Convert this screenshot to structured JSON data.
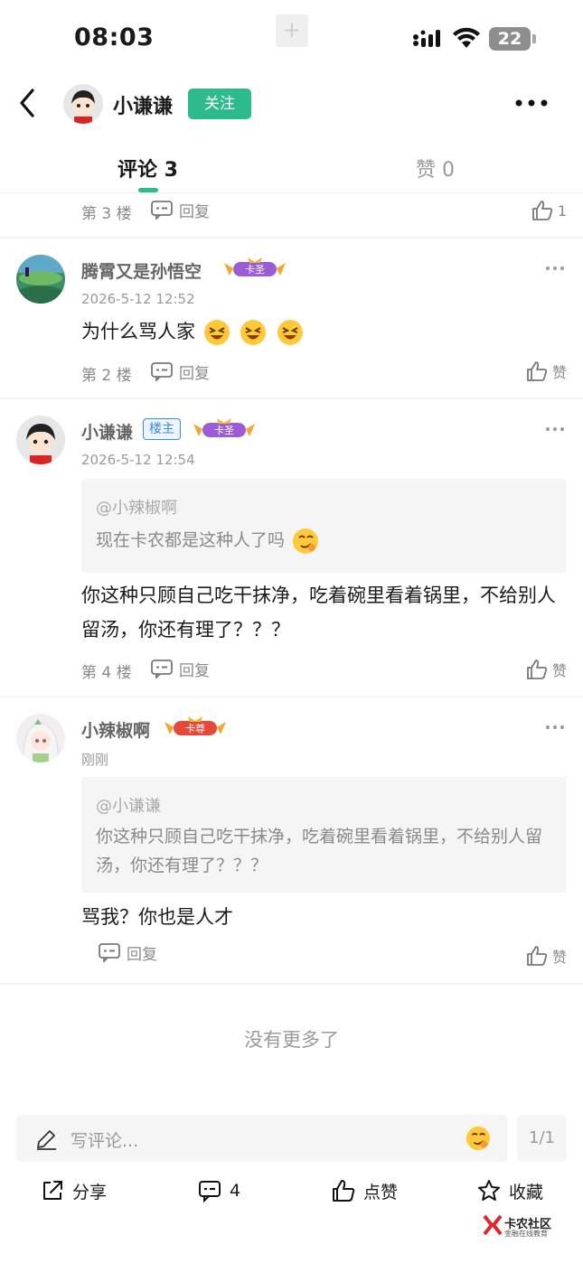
{
  "status_bar": {
    "time": "08:03",
    "battery": "22",
    "plus": "+"
  },
  "header": {
    "username": "小谦谦",
    "follow_label": "关注"
  },
  "tabs": {
    "comments": "评论 3",
    "likes": "赞 0"
  },
  "comments": [
    {
      "floor": "第 3 楼",
      "reply": "回复",
      "likes": "1"
    },
    {
      "name": "腾霄又是孙悟空",
      "badge": "卡圣",
      "time": "2026-5-12 12:52",
      "text": "为什么骂人家",
      "floor": "第 2 楼",
      "reply": "回复",
      "like": "赞"
    },
    {
      "name": "小谦谦",
      "owner_tag": "楼主",
      "badge": "卡圣",
      "time": "2026-5-12 12:54",
      "quote_author": "@小辣椒啊",
      "quote_text": "现在卡农都是这种人了吗",
      "text": "你这种只顾自己吃干抹净，吃着碗里看着锅里，不给别人留汤，你还有理了？？？",
      "floor": "第 4 楼",
      "reply": "回复",
      "like": "赞"
    },
    {
      "name": "小辣椒啊",
      "badge": "卡尊",
      "time": "刚刚",
      "quote_author": "@小谦谦",
      "quote_text": "你这种只顾自己吃干抹净，吃着碗里看着锅里，不给别人留汤，你还有理了？？？",
      "text": "骂我？你也是人才",
      "reply": "回复",
      "like": "赞"
    }
  ],
  "no_more": "没有更多了",
  "input": {
    "placeholder": "写评论...",
    "page": "1/1"
  },
  "actions": {
    "share": "分享",
    "comments": "4",
    "like": "点赞",
    "favorite": "收藏"
  },
  "brand": {
    "name": "卡农社区",
    "sub": "金融在线教育"
  },
  "colors": {
    "accent": "#2dba8f",
    "owner": "#3c8be0"
  }
}
